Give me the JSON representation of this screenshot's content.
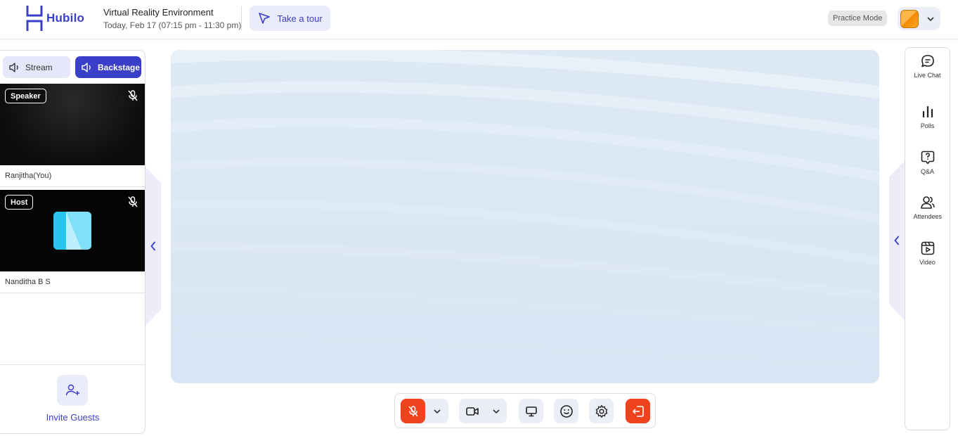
{
  "header": {
    "logo_text": "Hubilo",
    "event_title": "Virtual Reality Environment",
    "event_time": "Today, Feb 17 (07:15 pm - 11:30 pm)",
    "tour_label": "Take a tour",
    "practice_mode": "Practice Mode"
  },
  "left_panel": {
    "tabs": [
      {
        "label": "Stream",
        "active": false
      },
      {
        "label": "Backstage",
        "active": true
      }
    ],
    "participants": [
      {
        "role": "Speaker",
        "name": "Ranjitha(You)"
      },
      {
        "role": "Host",
        "name": "Nanditha B S"
      }
    ],
    "invite_label": "Invite Guests"
  },
  "right_panel": {
    "items": [
      {
        "label": "Live Chat",
        "icon": "chat-icon"
      },
      {
        "label": "Polls",
        "icon": "polls-icon"
      },
      {
        "label": "Q&A",
        "icon": "question-icon"
      },
      {
        "label": "Attendees",
        "icon": "attendees-icon"
      },
      {
        "label": "Video",
        "icon": "video-library-icon"
      }
    ]
  },
  "controls": [
    {
      "name": "mic-muted-button",
      "icon": "mic-off-icon"
    },
    {
      "name": "mic-options-dropdown",
      "icon": "chevron-down-icon"
    },
    {
      "name": "camera-button",
      "icon": "camera-icon"
    },
    {
      "name": "camera-options-dropdown",
      "icon": "chevron-down-icon"
    },
    {
      "name": "screen-share-button",
      "icon": "monitor-icon"
    },
    {
      "name": "reactions-button",
      "icon": "smiley-icon"
    },
    {
      "name": "settings-button",
      "icon": "gear-icon"
    },
    {
      "name": "leave-button",
      "icon": "exit-icon"
    }
  ],
  "colors": {
    "brand": "#3a3fc9",
    "danger": "#f0431d",
    "soft": "#eceef7",
    "stage_bg": "#d9e7f4"
  }
}
